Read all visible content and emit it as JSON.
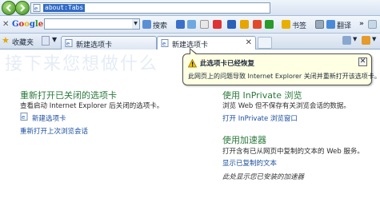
{
  "address": {
    "url": "about:Tabs"
  },
  "toolbar": {
    "close": "✕",
    "google": "Google",
    "search": "搜索",
    "bookmarks": "书签",
    "translate": "翻译",
    "more": "»"
  },
  "tabs": {
    "favorites": "收藏夹",
    "tab1": "新建选项卡",
    "tab2": "新建选项卡"
  },
  "page": {
    "watermark": "接下来您想做什么",
    "reopen_heading": "重新打开已关闭的选项卡",
    "reopen_desc": "查看启动 Internet Explorer 后关闭的选项卡。",
    "reopen_item": "新建选项卡",
    "reopen_session": "重新打开上次浏览会话",
    "inprivate_heading": "使用 InPrivate 浏览",
    "inprivate_desc": "浏览 Web 但不保存有关浏览会话的数据。",
    "inprivate_link": "打开 InPrivate 浏览窗口",
    "accelerator_heading": "使用加速器",
    "accelerator_desc": "打开含有已从网页中复制的文本的 Web 服务。",
    "accelerator_link": "显示已复制的文本",
    "accelerator_note": "此处显示您已安装的加速器"
  },
  "balloon": {
    "title": "此选项卡已经恢复",
    "body": "此网页上的问题导致 Internet Explorer 关闭并重新打开该选项卡。",
    "close": "✕"
  }
}
